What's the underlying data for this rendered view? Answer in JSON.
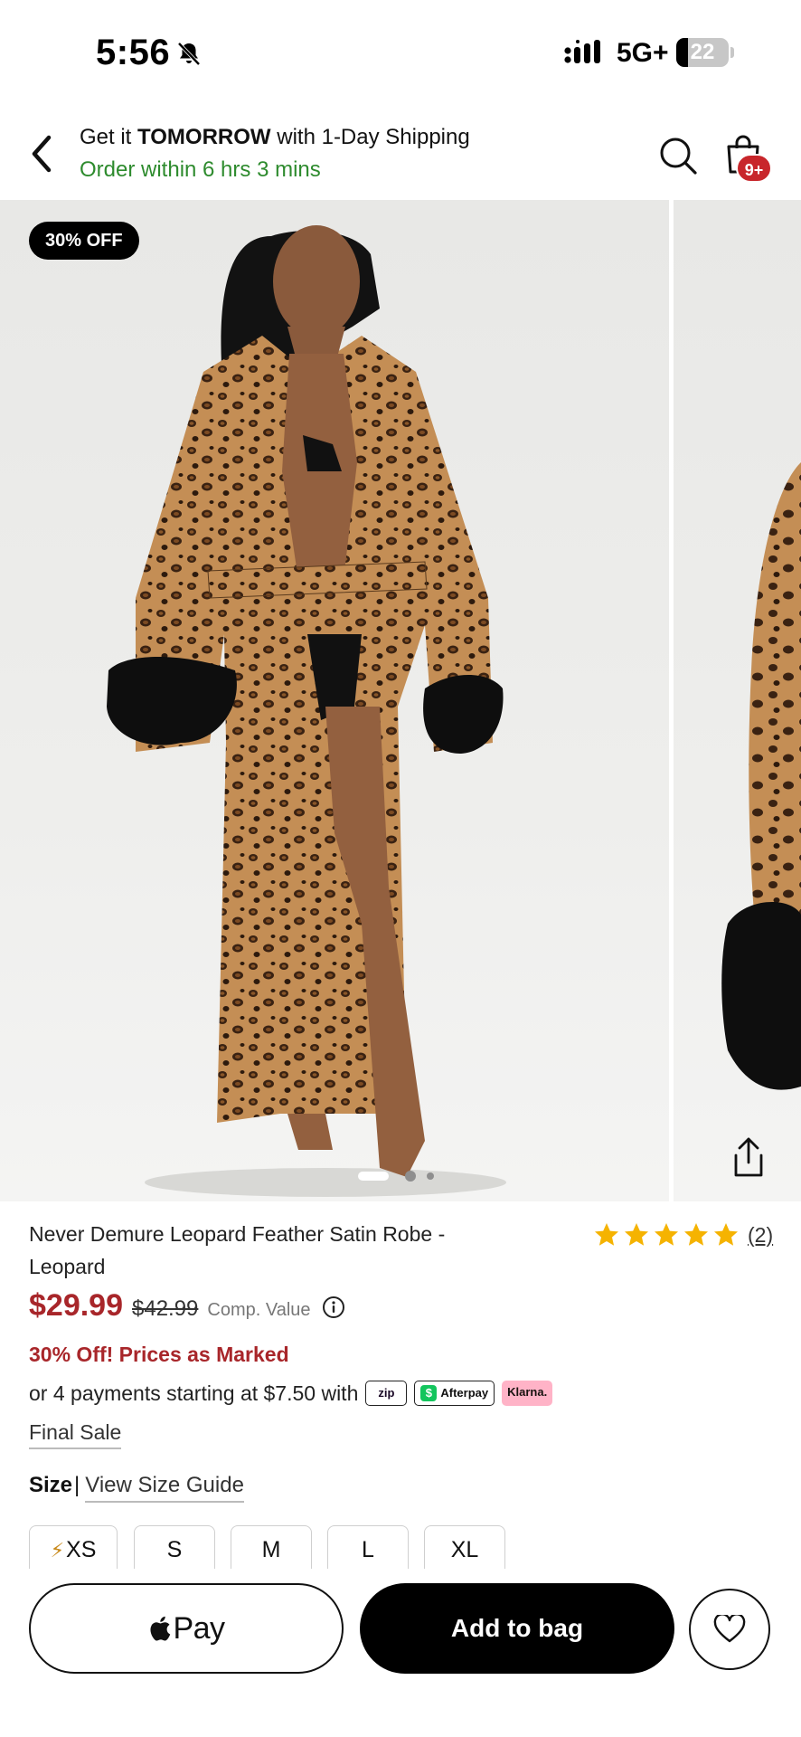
{
  "status_bar": {
    "time": "5:56",
    "network": "5G+",
    "battery_percent": "22",
    "battery_level": 0.22,
    "icons": [
      "bell-muted-icon",
      "cellular-signal-icon",
      "battery-icon"
    ]
  },
  "header": {
    "shipping_prefix": "Get it ",
    "shipping_emphasis": "TOMORROW",
    "shipping_suffix": " with 1-Day Shipping",
    "order_within": "Order within 6 hrs 3 mins",
    "bag_badge": "9+",
    "icons": [
      "back-icon",
      "search-icon",
      "shopping-bag-icon"
    ]
  },
  "gallery": {
    "discount_badge": "30% OFF",
    "current_slide": 1,
    "icons": [
      "share-icon"
    ]
  },
  "product": {
    "title": "Never Demure Leopard Feather Satin Robe - Leopard",
    "rating": 5,
    "review_count": "(2)",
    "price": "$29.99",
    "original_price": "$42.99",
    "comp_value_label": "Comp. Value",
    "promo": "30% Off! Prices as Marked",
    "payments_text": "or 4 payments starting at $7.50 with",
    "payment_providers": {
      "zip": "zip",
      "afterpay": "Afterpay",
      "afterpay_mark": "$",
      "klarna": "Klarna."
    },
    "final_sale": "Final Sale",
    "size_label": "Size",
    "size_separator": "|",
    "size_guide": "View Size Guide",
    "sizes": [
      {
        "label": "XS",
        "bolt": "⚡"
      },
      {
        "label": "S"
      },
      {
        "label": "M"
      },
      {
        "label": "L"
      },
      {
        "label": "XL"
      }
    ]
  },
  "actions": {
    "apple_pay_label": "Pay",
    "add_to_bag": "Add to bag"
  },
  "colors": {
    "accent_red": "#a8262a",
    "ship_green": "#2e8b2e",
    "badge_red": "#c8262b",
    "star_gold": "#f5b301"
  }
}
